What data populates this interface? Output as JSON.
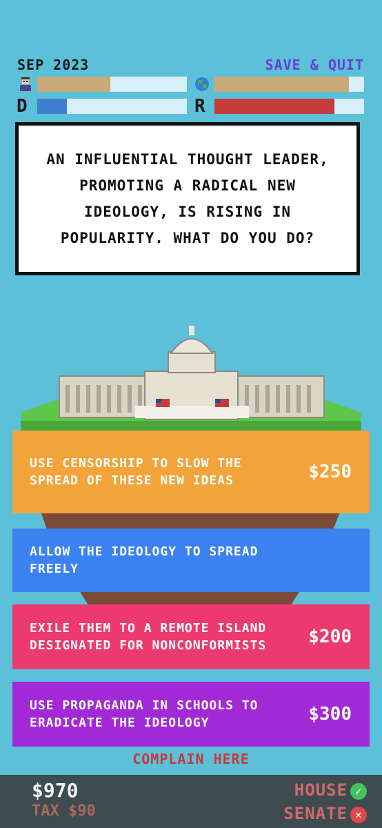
{
  "header": {
    "date": "SEP 2023",
    "save_label": "SAVE & QUIT"
  },
  "meters": {
    "public_icon": "person-icon",
    "world_icon": "globe-icon",
    "public_level": 0.49,
    "world_level": 0.9,
    "democrat_label": "D",
    "republican_label": "R",
    "democrat_level": 0.2,
    "republican_level": 0.8,
    "colors": {
      "public": "#c9a978",
      "world": "#c9a978",
      "democrat": "#3f7fd0",
      "republican": "#c43c3c",
      "empty": "#d7f0f7"
    }
  },
  "event": {
    "text": "AN INFLUENTIAL THOUGHT LEADER, PROMOTING A RADICAL NEW IDEOLOGY, IS RISING IN POPULARITY. WHAT DO YOU DO?"
  },
  "choices": [
    {
      "text": "USE CENSORSHIP TO SLOW THE SPREAD OF THESE NEW IDEAS",
      "cost": "$250",
      "color": "#f2a33a"
    },
    {
      "text": "ALLOW THE IDEOLOGY TO SPREAD FREELY",
      "cost": "",
      "color": "#3b82f0"
    },
    {
      "text": "EXILE THEM TO A REMOTE ISLAND DESIGNATED FOR NONCONFORMISTS",
      "cost": "$200",
      "color": "#ec3a6e"
    },
    {
      "text": "USE PROPAGANDA IN SCHOOLS TO ERADICATE THE IDEOLOGY",
      "cost": "$300",
      "color": "#a22ad6"
    }
  ],
  "complain_label": "COMPLAIN HERE",
  "footer": {
    "money": "$970",
    "tax": "TAX $90",
    "house_label": "HOUSE",
    "house_status": "check-icon",
    "senate_label": "SENATE",
    "senate_status": "x-icon"
  }
}
